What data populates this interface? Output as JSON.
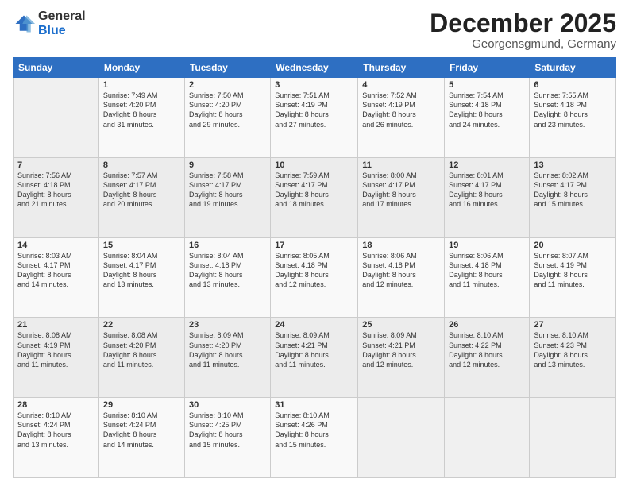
{
  "logo": {
    "general": "General",
    "blue": "Blue"
  },
  "header": {
    "month": "December 2025",
    "location": "Georgensgmund, Germany"
  },
  "days_of_week": [
    "Sunday",
    "Monday",
    "Tuesday",
    "Wednesday",
    "Thursday",
    "Friday",
    "Saturday"
  ],
  "weeks": [
    [
      {
        "day": "",
        "info": ""
      },
      {
        "day": "1",
        "info": "Sunrise: 7:49 AM\nSunset: 4:20 PM\nDaylight: 8 hours\nand 31 minutes."
      },
      {
        "day": "2",
        "info": "Sunrise: 7:50 AM\nSunset: 4:20 PM\nDaylight: 8 hours\nand 29 minutes."
      },
      {
        "day": "3",
        "info": "Sunrise: 7:51 AM\nSunset: 4:19 PM\nDaylight: 8 hours\nand 27 minutes."
      },
      {
        "day": "4",
        "info": "Sunrise: 7:52 AM\nSunset: 4:19 PM\nDaylight: 8 hours\nand 26 minutes."
      },
      {
        "day": "5",
        "info": "Sunrise: 7:54 AM\nSunset: 4:18 PM\nDaylight: 8 hours\nand 24 minutes."
      },
      {
        "day": "6",
        "info": "Sunrise: 7:55 AM\nSunset: 4:18 PM\nDaylight: 8 hours\nand 23 minutes."
      }
    ],
    [
      {
        "day": "7",
        "info": "Sunrise: 7:56 AM\nSunset: 4:18 PM\nDaylight: 8 hours\nand 21 minutes."
      },
      {
        "day": "8",
        "info": "Sunrise: 7:57 AM\nSunset: 4:17 PM\nDaylight: 8 hours\nand 20 minutes."
      },
      {
        "day": "9",
        "info": "Sunrise: 7:58 AM\nSunset: 4:17 PM\nDaylight: 8 hours\nand 19 minutes."
      },
      {
        "day": "10",
        "info": "Sunrise: 7:59 AM\nSunset: 4:17 PM\nDaylight: 8 hours\nand 18 minutes."
      },
      {
        "day": "11",
        "info": "Sunrise: 8:00 AM\nSunset: 4:17 PM\nDaylight: 8 hours\nand 17 minutes."
      },
      {
        "day": "12",
        "info": "Sunrise: 8:01 AM\nSunset: 4:17 PM\nDaylight: 8 hours\nand 16 minutes."
      },
      {
        "day": "13",
        "info": "Sunrise: 8:02 AM\nSunset: 4:17 PM\nDaylight: 8 hours\nand 15 minutes."
      }
    ],
    [
      {
        "day": "14",
        "info": "Sunrise: 8:03 AM\nSunset: 4:17 PM\nDaylight: 8 hours\nand 14 minutes."
      },
      {
        "day": "15",
        "info": "Sunrise: 8:04 AM\nSunset: 4:17 PM\nDaylight: 8 hours\nand 13 minutes."
      },
      {
        "day": "16",
        "info": "Sunrise: 8:04 AM\nSunset: 4:18 PM\nDaylight: 8 hours\nand 13 minutes."
      },
      {
        "day": "17",
        "info": "Sunrise: 8:05 AM\nSunset: 4:18 PM\nDaylight: 8 hours\nand 12 minutes."
      },
      {
        "day": "18",
        "info": "Sunrise: 8:06 AM\nSunset: 4:18 PM\nDaylight: 8 hours\nand 12 minutes."
      },
      {
        "day": "19",
        "info": "Sunrise: 8:06 AM\nSunset: 4:18 PM\nDaylight: 8 hours\nand 11 minutes."
      },
      {
        "day": "20",
        "info": "Sunrise: 8:07 AM\nSunset: 4:19 PM\nDaylight: 8 hours\nand 11 minutes."
      }
    ],
    [
      {
        "day": "21",
        "info": "Sunrise: 8:08 AM\nSunset: 4:19 PM\nDaylight: 8 hours\nand 11 minutes."
      },
      {
        "day": "22",
        "info": "Sunrise: 8:08 AM\nSunset: 4:20 PM\nDaylight: 8 hours\nand 11 minutes."
      },
      {
        "day": "23",
        "info": "Sunrise: 8:09 AM\nSunset: 4:20 PM\nDaylight: 8 hours\nand 11 minutes."
      },
      {
        "day": "24",
        "info": "Sunrise: 8:09 AM\nSunset: 4:21 PM\nDaylight: 8 hours\nand 11 minutes."
      },
      {
        "day": "25",
        "info": "Sunrise: 8:09 AM\nSunset: 4:21 PM\nDaylight: 8 hours\nand 12 minutes."
      },
      {
        "day": "26",
        "info": "Sunrise: 8:10 AM\nSunset: 4:22 PM\nDaylight: 8 hours\nand 12 minutes."
      },
      {
        "day": "27",
        "info": "Sunrise: 8:10 AM\nSunset: 4:23 PM\nDaylight: 8 hours\nand 13 minutes."
      }
    ],
    [
      {
        "day": "28",
        "info": "Sunrise: 8:10 AM\nSunset: 4:24 PM\nDaylight: 8 hours\nand 13 minutes."
      },
      {
        "day": "29",
        "info": "Sunrise: 8:10 AM\nSunset: 4:24 PM\nDaylight: 8 hours\nand 14 minutes."
      },
      {
        "day": "30",
        "info": "Sunrise: 8:10 AM\nSunset: 4:25 PM\nDaylight: 8 hours\nand 15 minutes."
      },
      {
        "day": "31",
        "info": "Sunrise: 8:10 AM\nSunset: 4:26 PM\nDaylight: 8 hours\nand 15 minutes."
      },
      {
        "day": "",
        "info": ""
      },
      {
        "day": "",
        "info": ""
      },
      {
        "day": "",
        "info": ""
      }
    ]
  ]
}
